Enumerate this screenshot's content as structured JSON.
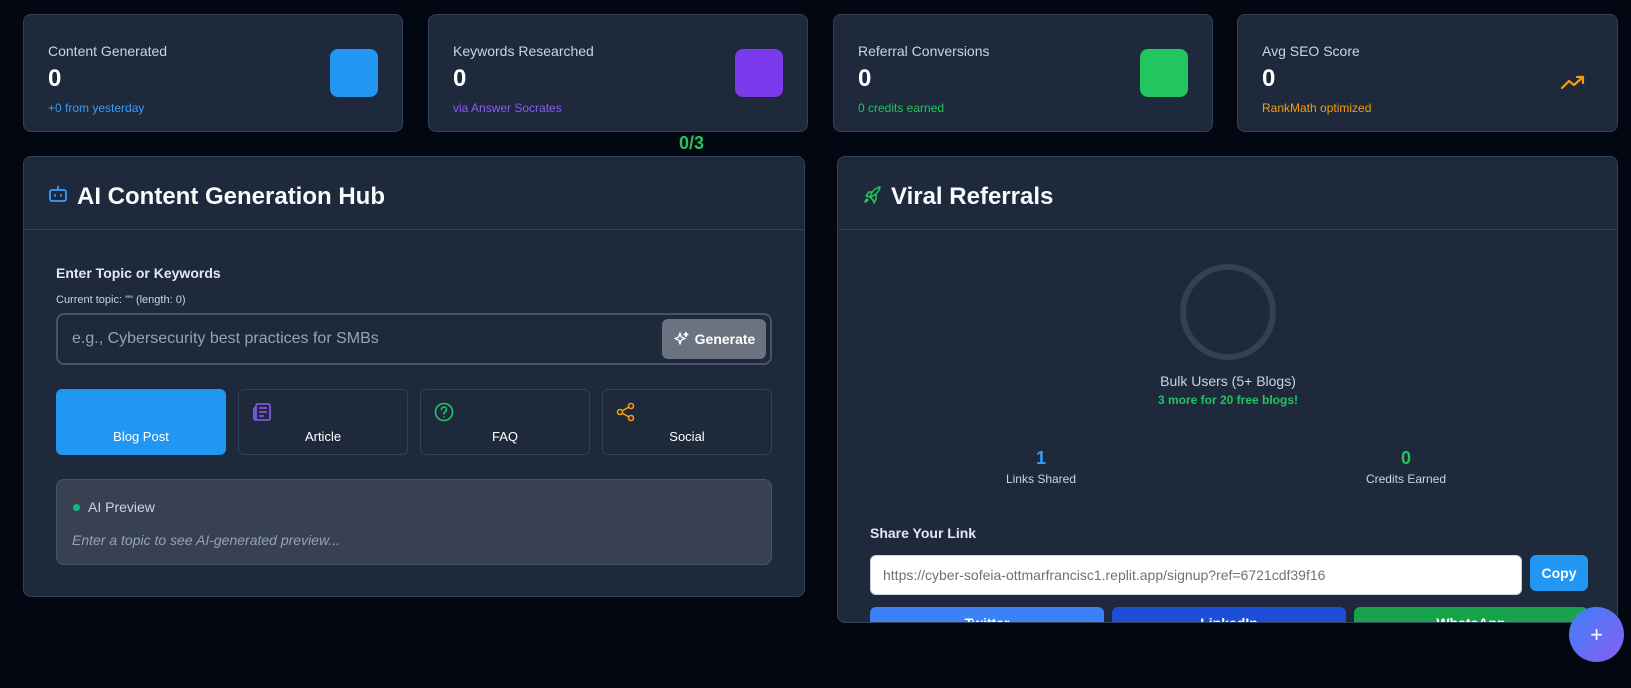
{
  "stats": [
    {
      "title": "Content Generated",
      "value": "0",
      "sub": "+0 from yesterday",
      "sub_color": "#3b9cf6",
      "icon_color": "#2196f3",
      "icon": "content-icon"
    },
    {
      "title": "Keywords Researched",
      "value": "0",
      "sub": "via Answer Socrates",
      "sub_color": "#8b5cf6",
      "icon_color": "#7c3aed",
      "icon": "keywords-icon"
    },
    {
      "title": "Referral Conversions",
      "value": "0",
      "sub": "0 credits earned",
      "sub_color": "#22c55e",
      "icon_color": "#22c55e",
      "icon": "referral-icon"
    },
    {
      "title": "Avg SEO Score",
      "value": "0",
      "sub": "RankMath optimized",
      "sub_color": "#f59e0b",
      "icon": "trending-up-icon"
    }
  ],
  "counter": "0/3",
  "content_hub": {
    "title": "AI Content Generation Hub",
    "topic_label": "Enter Topic or Keywords",
    "topic_hint": "Current topic: \"\" (length: 0)",
    "topic_value": "",
    "topic_placeholder": "e.g., Cybersecurity best practices for SMBs",
    "generate_label": "Generate",
    "types": [
      {
        "label": "Blog Post",
        "active": true
      },
      {
        "label": "Article",
        "active": false,
        "icon": "newspaper-icon"
      },
      {
        "label": "FAQ",
        "active": false,
        "icon": "help-circle-icon"
      },
      {
        "label": "Social",
        "active": false,
        "icon": "share-icon"
      }
    ],
    "preview_title": "AI Preview",
    "preview_text": "Enter a topic to see AI-generated preview..."
  },
  "referrals": {
    "title": "Viral Referrals",
    "progress": 0,
    "bulk_label": "Bulk Users (5+ Blogs)",
    "bulk_sub": "3 more for 20 free blogs!",
    "links_shared": "1",
    "links_shared_label": "Links Shared",
    "credits_earned": "0",
    "credits_earned_label": "Credits Earned",
    "share_label": "Share Your Link",
    "share_url": "https://cyber-sofeia-ottmarfrancisc1.replit.app/signup?ref=6721cdf39f16",
    "copy_label": "Copy",
    "social_buttons": [
      "Twitter",
      "LinkedIn",
      "WhatsApp"
    ]
  },
  "fab_label": "+"
}
